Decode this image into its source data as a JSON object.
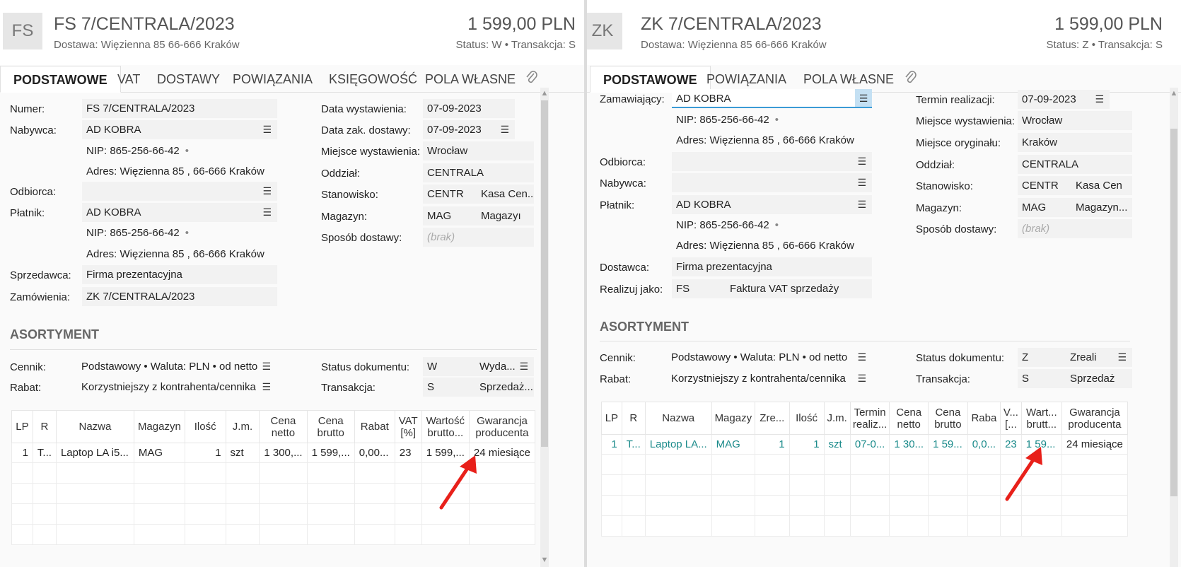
{
  "left": {
    "badge": "FS",
    "title": "FS 7/CENTRALA/2023",
    "address": "Dostawa: Więzienna  85  66-666 Kraków",
    "amount": "1 599,00 PLN",
    "status": "Status:  W  •  Transakcja:  S",
    "tabs": [
      "PODSTAWOWE",
      "VAT",
      "DOSTAWY",
      "POWIĄZANIA",
      "KSIĘGOWOŚĆ",
      "POLA WŁASNE"
    ],
    "form": {
      "numer_label": "Numer:",
      "numer": "FS 7/CENTRALA/2023",
      "nabywca_label": "Nabywca:",
      "nabywca": "AD KOBRA",
      "nip1": "NIP:  865-256-66-42",
      "adres1": "Adres:  Więzienna  85 , 66-666 Kraków",
      "odbiorca_label": "Odbiorca:",
      "platnik_label": "Płatnik:",
      "platnik": "AD KOBRA",
      "nip2": "NIP:  865-256-66-42",
      "adres2": "Adres:  Więzienna  85 , 66-666 Kraków",
      "sprzedawca_label": "Sprzedawca:",
      "sprzedawca": "Firma prezentacyjna",
      "zamowienia_label": "Zamówienia:",
      "zamowienia": "ZK 7/CENTRALA/2023",
      "data_wyst_label": "Data wystawienia:",
      "data_wyst": "07-09-2023",
      "data_dost_label": "Data zak. dostawy:",
      "data_dost": "07-09-2023",
      "miejsce_label": "Miejsce wystawienia:",
      "miejsce": "Wrocław",
      "oddzial_label": "Oddział:",
      "oddzial": "CENTRALA",
      "stanowisko_label": "Stanowisko:",
      "stanowisko_code": "CENTR",
      "stanowisko_name": "Kasa Cen...",
      "magazyn_label": "Magazyn:",
      "magazyn_code": "MAG",
      "magazyn_name": "Magazyı",
      "sposob_label": "Sposób dostawy:",
      "sposob": "(brak)"
    },
    "asortyment": {
      "title": "ASORTYMENT",
      "cennik_label": "Cennik:",
      "cennik": "Podstawowy • Waluta: PLN • od netto",
      "rabat_label": "Rabat:",
      "rabat": "Korzystniejszy z kontrahenta/cennika",
      "status_label": "Status dokumentu:",
      "status_code": "W",
      "status_name": "Wyda...",
      "transakcja_label": "Transakcja:",
      "transakcja_code": "S",
      "transakcja_name": "Sprzedaż..."
    },
    "columns": [
      "LP",
      "R",
      "Nazwa",
      "Magazyn",
      "Ilość",
      "J.m.",
      "Cena\nnetto",
      "Cena\nbrutto",
      "Rabat",
      "VAT\n[%]",
      "Wartość\nbrutto...",
      "Gwarancja\nproducenta"
    ],
    "row": [
      "1",
      "T...",
      "Laptop LA i5...",
      "MAG",
      "1",
      "szt",
      "1 300,...",
      "1 599,...",
      "0,00...",
      "23",
      "1 599,...",
      "24 miesiące"
    ]
  },
  "right": {
    "badge": "ZK",
    "title": "ZK 7/CENTRALA/2023",
    "address": "Dostawa: Więzienna  85  66-666 Kraków",
    "amount": "1 599,00 PLN",
    "status": "Status:  Z  •  Transakcja:  S",
    "tabs": [
      "PODSTAWOWE",
      "POWIĄZANIA",
      "POLA WŁASNE"
    ],
    "form": {
      "zamawiajacy_label": "Zamawiający:",
      "zamawiajacy": "AD KOBRA",
      "nip1": "NIP:  865-256-66-42",
      "adres1": "Adres:  Więzienna  85 , 66-666 Kraków",
      "odbiorca_label": "Odbiorca:",
      "nabywca_label": "Nabywca:",
      "platnik_label": "Płatnik:",
      "platnik": "AD KOBRA",
      "nip2": "NIP:  865-256-66-42",
      "adres2": "Adres:  Więzienna  85 , 66-666 Kraków",
      "dostawca_label": "Dostawca:",
      "dostawca": "Firma prezentacyjna",
      "realizuj_label": "Realizuj jako:",
      "realizuj_code": "FS",
      "realizuj_name": "Faktura VAT sprzedaży",
      "termin_label": "Termin realizacji:",
      "termin": "07-09-2023",
      "miejsce_label": "Miejsce wystawienia:",
      "miejsce": "Wrocław",
      "oryginal_label": "Miejsce oryginału:",
      "oryginal": "Kraków",
      "oddzial_label": "Oddział:",
      "oddzial": "CENTRALA",
      "stanowisko_label": "Stanowisko:",
      "stanowisko_code": "CENTR",
      "stanowisko_name": "Kasa Cen",
      "magazyn_label": "Magazyn:",
      "magazyn_code": "MAG",
      "magazyn_name": "Magazyn...",
      "sposob_label": "Sposób dostawy:",
      "sposob": "(brak)"
    },
    "asortyment": {
      "title": "ASORTYMENT",
      "cennik_label": "Cennik:",
      "cennik": "Podstawowy • Waluta: PLN • od netto",
      "rabat_label": "Rabat:",
      "rabat": "Korzystniejszy z kontrahenta/cennika",
      "status_label": "Status dokumentu:",
      "status_code": "Z",
      "status_name": "Zreali",
      "transakcja_label": "Transakcja:",
      "transakcja_code": "S",
      "transakcja_name": "Sprzedaż"
    },
    "columns": [
      "LP",
      "R",
      "Nazwa",
      "Magazy",
      "Zre...",
      "Ilość",
      "J.m.",
      "Termin\nrealiz...",
      "Cena\nnetto",
      "Cena\nbrutto",
      "Raba",
      "V...\n[...",
      "Wart...\nbrutt...",
      "Gwarancja\nproducenta"
    ],
    "row": [
      "1",
      "T...",
      "Laptop LA...",
      "MAG",
      "1",
      "1",
      "szt",
      "07-0...",
      "1 30...",
      "1 59...",
      "0,0...",
      "23",
      "1 59...",
      "24 miesiące"
    ]
  },
  "colors": {
    "accent": "#3b9bd6",
    "teal": "#1a8a8a",
    "arrow": "#e8201a"
  },
  "icons": {
    "menu": "hamburger-icon",
    "attach": "paperclip-icon"
  }
}
